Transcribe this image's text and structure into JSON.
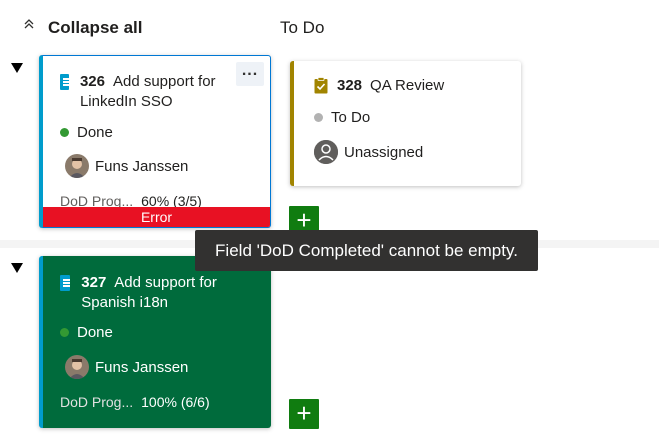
{
  "header": {
    "collapse_label": "Collapse all",
    "column_title": "To Do"
  },
  "cards": {
    "c326": {
      "id": "326",
      "title": "Add support for LinkedIn SSO",
      "state": "Done",
      "assignee": "Funs Janssen",
      "field_label": "DoD Prog...",
      "field_value": "60% (3/5)",
      "error_label": "Error",
      "more_label": "..."
    },
    "c328": {
      "id": "328",
      "title": "QA Review",
      "state": "To Do",
      "assignee": "Unassigned"
    },
    "c327": {
      "id": "327",
      "title": "Add support for Spanish i18n",
      "state": "Done",
      "assignee": "Funs Janssen",
      "field_label": "DoD Prog...",
      "field_value": "100% (6/6)"
    }
  },
  "tooltip": "Field 'DoD Completed' cannot be empty.",
  "add_label": "+",
  "colors": {
    "done_state": "#339933",
    "todo_state": "#b2b2b2",
    "story_accent": "#009ccc",
    "task_accent": "#a18400",
    "error": "#e81123",
    "add_button": "#107c10",
    "completed_card": "#006b3c"
  },
  "icons": {
    "collapse": "chevron-double-up-icon",
    "lane_toggle": "triangle-down-icon",
    "user_story": "user-story-icon",
    "task": "clipboard-task-icon",
    "unassigned": "unassigned-person-icon"
  }
}
